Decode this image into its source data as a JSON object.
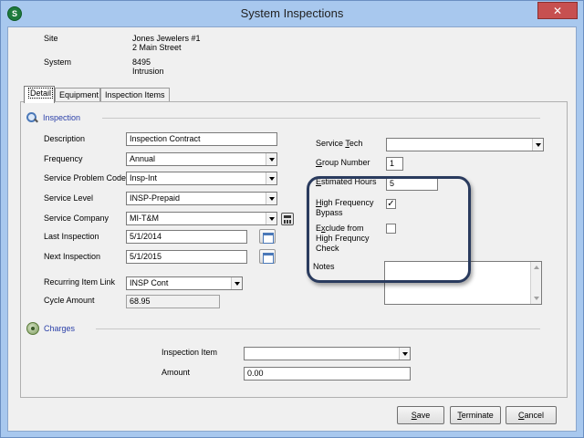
{
  "window": {
    "title": "System Inspections",
    "app_icon_letter": "S",
    "close_glyph": "✕"
  },
  "header": {
    "site_label": "Site",
    "site_name": "Jones Jewelers #1",
    "site_address": "2 Main Street",
    "system_label": "System",
    "system_number": "8495",
    "system_type": "Intrusion"
  },
  "tabs": [
    {
      "label": "Detail",
      "active": true
    },
    {
      "label": "Equipment",
      "active": false
    },
    {
      "label": "Inspection Items",
      "active": false
    }
  ],
  "inspection": {
    "section_title": "Inspection",
    "description_label": "Description",
    "description_value": "Inspection Contract",
    "frequency_label": "Frequency",
    "frequency_value": "Annual",
    "service_problem_code_label": "Service Problem Code",
    "service_problem_code_value": "Insp-Int",
    "service_level_label": "Service Level",
    "service_level_value": "INSP-Prepaid",
    "service_company_label": "Service Company",
    "service_company_value": "MI-T&M",
    "last_inspection_label": "Last Inspection",
    "last_inspection_value": "5/1/2014",
    "next_inspection_label": "Next Inspection",
    "next_inspection_value": "5/1/2015",
    "recurring_item_link_label": "Recurring Item Link",
    "recurring_item_link_value": "INSP Cont",
    "cycle_amount_label": "Cycle Amount",
    "cycle_amount_value": "68.95"
  },
  "right_panel": {
    "service_tech_label": "Service Tech",
    "service_tech_value": "",
    "group_number_label": "Group Number",
    "group_number_value": "1",
    "estimated_hours_label": "Estimated Hours",
    "estimated_hours_value": "5",
    "high_frequency_bypass_label_1": "High Frequency",
    "high_frequency_bypass_label_2": "Bypass",
    "high_frequency_bypass_checked": "✓",
    "exclude_label_1": "Exclude from",
    "exclude_label_2": "High Frequncy",
    "exclude_label_3": "Check",
    "notes_label": "Notes"
  },
  "charges": {
    "section_title": "Charges",
    "inspection_item_label": "Inspection Item",
    "inspection_item_value": "",
    "amount_label": "Amount",
    "amount_value": "0.00"
  },
  "buttons": {
    "save": "Save",
    "terminate": "Terminate",
    "cancel": "Cancel"
  }
}
